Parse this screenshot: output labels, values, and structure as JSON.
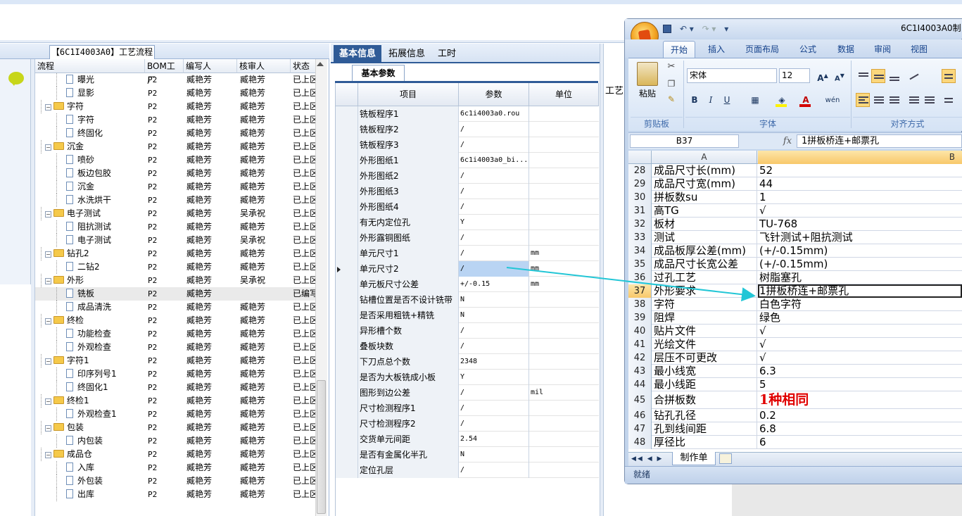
{
  "left_panel": {
    "tab_title": "【6C1I4003A0】工艺流程",
    "columns": [
      "流程",
      "BOM工厂",
      "编写人",
      "核审人",
      "状态"
    ],
    "rows": [
      {
        "level": 2,
        "type": "doc",
        "name": "曝光",
        "bom": "P2",
        "writer": "臧艳芳",
        "checker": "臧艳芳",
        "status": "已上区"
      },
      {
        "level": 2,
        "type": "doc",
        "name": "显影",
        "bom": "P2",
        "writer": "臧艳芳",
        "checker": "臧艳芳",
        "status": "已上区"
      },
      {
        "level": 1,
        "type": "folder",
        "name": "字符",
        "bom": "P2",
        "writer": "臧艳芳",
        "checker": "臧艳芳",
        "status": "已上区"
      },
      {
        "level": 2,
        "type": "doc",
        "name": "字符",
        "bom": "P2",
        "writer": "臧艳芳",
        "checker": "臧艳芳",
        "status": "已上区"
      },
      {
        "level": 2,
        "type": "doc",
        "name": "终固化",
        "bom": "P2",
        "writer": "臧艳芳",
        "checker": "臧艳芳",
        "status": "已上区"
      },
      {
        "level": 1,
        "type": "folder",
        "name": "沉金",
        "bom": "P2",
        "writer": "臧艳芳",
        "checker": "臧艳芳",
        "status": "已上区"
      },
      {
        "level": 2,
        "type": "doc",
        "name": "喷砂",
        "bom": "P2",
        "writer": "臧艳芳",
        "checker": "臧艳芳",
        "status": "已上区"
      },
      {
        "level": 2,
        "type": "doc",
        "name": "板边包胶",
        "bom": "P2",
        "writer": "臧艳芳",
        "checker": "臧艳芳",
        "status": "已上区"
      },
      {
        "level": 2,
        "type": "doc",
        "name": "沉金",
        "bom": "P2",
        "writer": "臧艳芳",
        "checker": "臧艳芳",
        "status": "已上区"
      },
      {
        "level": 2,
        "type": "doc",
        "name": "水洗烘干",
        "bom": "P2",
        "writer": "臧艳芳",
        "checker": "臧艳芳",
        "status": "已上区"
      },
      {
        "level": 1,
        "type": "folder",
        "name": "电子测试",
        "bom": "P2",
        "writer": "臧艳芳",
        "checker": "吴承祝",
        "status": "已上区"
      },
      {
        "level": 2,
        "type": "doc",
        "name": "阻抗测试",
        "bom": "P2",
        "writer": "臧艳芳",
        "checker": "臧艳芳",
        "status": "已上区"
      },
      {
        "level": 2,
        "type": "doc",
        "name": "电子测试",
        "bom": "P2",
        "writer": "臧艳芳",
        "checker": "吴承祝",
        "status": "已上区"
      },
      {
        "level": 1,
        "type": "folder",
        "name": "钻孔2",
        "bom": "P2",
        "writer": "臧艳芳",
        "checker": "臧艳芳",
        "status": "已上区"
      },
      {
        "level": 2,
        "type": "doc",
        "name": "二钻2",
        "bom": "P2",
        "writer": "臧艳芳",
        "checker": "臧艳芳",
        "status": "已上区"
      },
      {
        "level": 1,
        "type": "folder",
        "name": "外形",
        "bom": "P2",
        "writer": "臧艳芳",
        "checker": "吴承祝",
        "status": "已上区"
      },
      {
        "level": 2,
        "type": "doc",
        "name": "铣板",
        "bom": "P2",
        "writer": "臧艳芳",
        "checker": "",
        "status": "已编写",
        "selected": true
      },
      {
        "level": 2,
        "type": "doc",
        "name": "成品清洗",
        "bom": "P2",
        "writer": "臧艳芳",
        "checker": "臧艳芳",
        "status": "已上区"
      },
      {
        "level": 1,
        "type": "folder",
        "name": "终检",
        "bom": "P2",
        "writer": "臧艳芳",
        "checker": "臧艳芳",
        "status": "已上区"
      },
      {
        "level": 2,
        "type": "doc",
        "name": "功能检查",
        "bom": "P2",
        "writer": "臧艳芳",
        "checker": "臧艳芳",
        "status": "已上区"
      },
      {
        "level": 2,
        "type": "doc",
        "name": "外观检查",
        "bom": "P2",
        "writer": "臧艳芳",
        "checker": "臧艳芳",
        "status": "已上区"
      },
      {
        "level": 1,
        "type": "folder",
        "name": "字符1",
        "bom": "P2",
        "writer": "臧艳芳",
        "checker": "臧艳芳",
        "status": "已上区"
      },
      {
        "level": 2,
        "type": "doc",
        "name": "印序列号1",
        "bom": "P2",
        "writer": "臧艳芳",
        "checker": "臧艳芳",
        "status": "已上区"
      },
      {
        "level": 2,
        "type": "doc",
        "name": "终固化1",
        "bom": "P2",
        "writer": "臧艳芳",
        "checker": "臧艳芳",
        "status": "已上区"
      },
      {
        "level": 1,
        "type": "folder",
        "name": "终检1",
        "bom": "P2",
        "writer": "臧艳芳",
        "checker": "臧艳芳",
        "status": "已上区"
      },
      {
        "level": 2,
        "type": "doc",
        "name": "外观检查1",
        "bom": "P2",
        "writer": "臧艳芳",
        "checker": "臧艳芳",
        "status": "已上区"
      },
      {
        "level": 1,
        "type": "folder",
        "name": "包装",
        "bom": "P2",
        "writer": "臧艳芳",
        "checker": "臧艳芳",
        "status": "已上区"
      },
      {
        "level": 2,
        "type": "doc",
        "name": "内包装",
        "bom": "P2",
        "writer": "臧艳芳",
        "checker": "臧艳芳",
        "status": "已上区"
      },
      {
        "level": 1,
        "type": "folder",
        "name": "成品仓",
        "bom": "P2",
        "writer": "臧艳芳",
        "checker": "臧艳芳",
        "status": "已上区"
      },
      {
        "level": 2,
        "type": "doc",
        "name": "入库",
        "bom": "P2",
        "writer": "臧艳芳",
        "checker": "臧艳芳",
        "status": "已上区"
      },
      {
        "level": 2,
        "type": "doc",
        "name": "外包装",
        "bom": "P2",
        "writer": "臧艳芳",
        "checker": "臧艳芳",
        "status": "已上区"
      },
      {
        "level": 2,
        "type": "doc",
        "name": "出库",
        "bom": "P2",
        "writer": "臧艳芳",
        "checker": "臧艳芳",
        "status": "已上区"
      }
    ]
  },
  "middle_panel": {
    "tabs": [
      "基本信息",
      "拓展信息",
      "工时"
    ],
    "sub_tab": "基本参数",
    "columns": [
      "项目",
      "参数",
      "单位"
    ],
    "rows": [
      {
        "item": "铣板程序1",
        "param": "6c1i4003a0.rou",
        "unit": ""
      },
      {
        "item": "铣板程序2",
        "param": "/",
        "unit": ""
      },
      {
        "item": "铣板程序3",
        "param": "/",
        "unit": ""
      },
      {
        "item": "外形图纸1",
        "param": "6c1i4003a0_bi...",
        "unit": ""
      },
      {
        "item": "外形图纸2",
        "param": "/",
        "unit": ""
      },
      {
        "item": "外形图纸3",
        "param": "/",
        "unit": ""
      },
      {
        "item": "外形图纸4",
        "param": "/",
        "unit": ""
      },
      {
        "item": "有无内定位孔",
        "param": "Y",
        "unit": ""
      },
      {
        "item": "外形露铜图纸",
        "param": "/",
        "unit": ""
      },
      {
        "item": "单元尺寸1",
        "param": "/",
        "unit": "mm"
      },
      {
        "item": "单元尺寸2",
        "param": "/",
        "unit": "mm",
        "highlight": true
      },
      {
        "item": "单元板尺寸公差",
        "param": "+/-0.15",
        "unit": "mm"
      },
      {
        "item": "钻槽位置是否不设计铣带",
        "param": "N",
        "unit": ""
      },
      {
        "item": "是否采用粗铣+精铣",
        "param": "N",
        "unit": ""
      },
      {
        "item": "异形槽个数",
        "param": "/",
        "unit": ""
      },
      {
        "item": "叠板块数",
        "param": "/",
        "unit": ""
      },
      {
        "item": "下刀点总个数",
        "param": "2348",
        "unit": ""
      },
      {
        "item": "是否为大板铣成小板",
        "param": "Y",
        "unit": ""
      },
      {
        "item": "图形到边公差",
        "param": "/",
        "unit": "mil"
      },
      {
        "item": "尺寸检测程序1",
        "param": "/",
        "unit": ""
      },
      {
        "item": "尺寸检测程序2",
        "param": "/",
        "unit": ""
      },
      {
        "item": "交货单元间距",
        "param": "2.54",
        "unit": ""
      },
      {
        "item": "是否有金属化半孔",
        "param": "N",
        "unit": ""
      },
      {
        "item": "定位孔层",
        "param": "/",
        "unit": ""
      }
    ]
  },
  "right_background_tab": "工艺",
  "excel": {
    "title": "6C1I4003A0制",
    "ribbon_tabs": [
      "开始",
      "插入",
      "页面布局",
      "公式",
      "数据",
      "审阅",
      "视图"
    ],
    "clipboard": {
      "paste": "粘贴",
      "group": "剪贴板"
    },
    "font": {
      "name": "宋体",
      "size": "12",
      "group": "字体"
    },
    "align_group": "对齐方式",
    "name_box": "B37",
    "fx": "fx",
    "formula": "1拼板桥连+邮票孔",
    "col_a": "A",
    "col_b": "B",
    "rows": [
      {
        "n": "28",
        "a": "成品尺寸长(mm)",
        "b": "52"
      },
      {
        "n": "29",
        "a": "成品尺寸宽(mm)",
        "b": "44"
      },
      {
        "n": "30",
        "a": "拼板数su",
        "b": "1"
      },
      {
        "n": "31",
        "a": "高TG",
        "b": "√"
      },
      {
        "n": "32",
        "a": "板材",
        "b": "TU-768"
      },
      {
        "n": "33",
        "a": "测试",
        "b": "飞针测试+阻抗测试"
      },
      {
        "n": "34",
        "a": "成品板厚公差(mm)",
        "b": "(+/-0.15mm)"
      },
      {
        "n": "35",
        "a": "成品尺寸长宽公差",
        "b": "(+/-0.15mm)"
      },
      {
        "n": "36",
        "a": "过孔工艺",
        "b": "树脂塞孔"
      },
      {
        "n": "37",
        "a": "外形要求",
        "b": "1拼板桥连+邮票孔",
        "active": true
      },
      {
        "n": "38",
        "a": "字符",
        "b": "白色字符"
      },
      {
        "n": "39",
        "a": "阻焊",
        "b": "绿色"
      },
      {
        "n": "40",
        "a": "贴片文件",
        "b": "√"
      },
      {
        "n": "41",
        "a": "光绘文件",
        "b": "√"
      },
      {
        "n": "42",
        "a": "层压不可更改",
        "b": "√"
      },
      {
        "n": "43",
        "a": "最小线宽",
        "b": "6.3"
      },
      {
        "n": "44",
        "a": "最小线距",
        "b": "5"
      },
      {
        "n": "45",
        "a": "合拼板数",
        "b": "1种相同",
        "big": true,
        "red": true
      },
      {
        "n": "46",
        "a": "钻孔孔径",
        "b": "0.2"
      },
      {
        "n": "47",
        "a": "孔到线间距",
        "b": "6.8"
      },
      {
        "n": "48",
        "a": "厚径比",
        "b": "6"
      }
    ],
    "sheet_tab": "制作单",
    "status": "就绪"
  },
  "colors": {
    "accent": "#2f5b97",
    "arrow": "#22c6d6",
    "excel_frame": "#c3d5ec"
  }
}
